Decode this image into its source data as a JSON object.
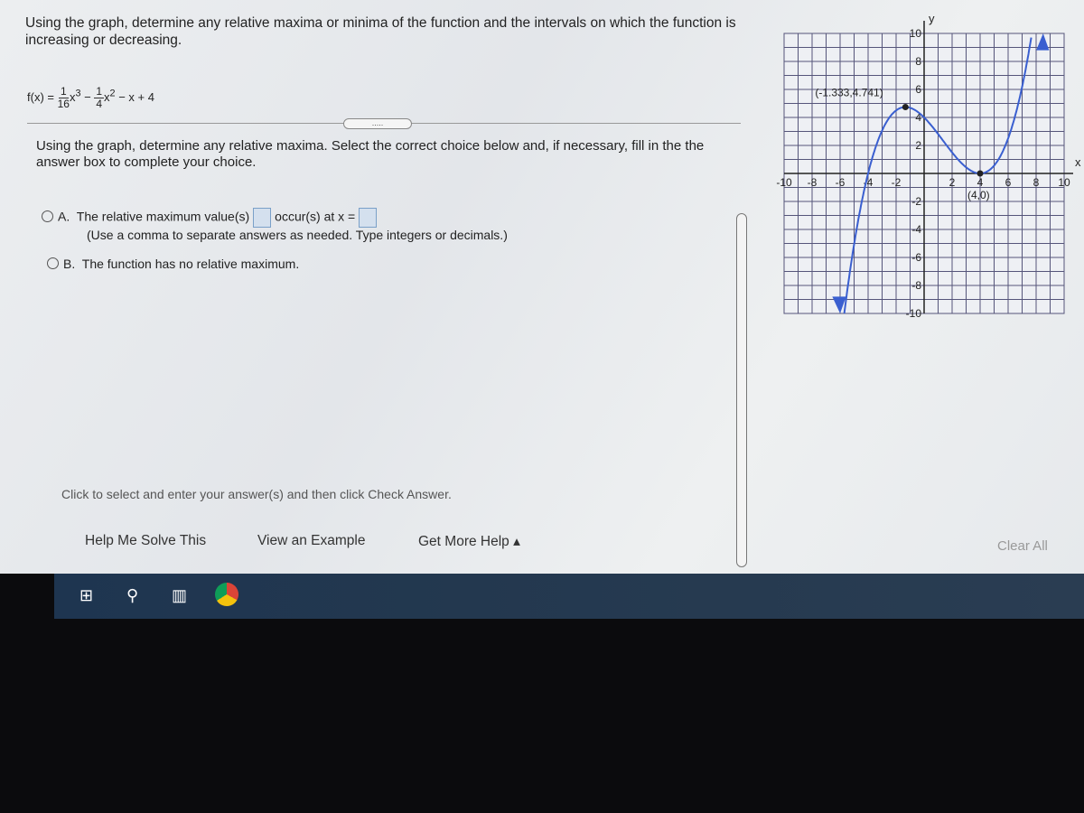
{
  "question": "Using the graph, determine any relative maxima or minima of the function and the intervals on which the function is increasing or decreasing.",
  "function": {
    "lhs": "f(x) =",
    "a_num": "1",
    "a_den": "16",
    "t1": "x",
    "e1": "3",
    "minus": "−",
    "b_num": "1",
    "b_den": "4",
    "t2": "x",
    "e2": "2",
    "rest": "− x + 4"
  },
  "more_button": ".....",
  "subquestion": "Using the graph, determine any relative maxima. Select the correct choice below and, if necessary, fill in the the answer box to complete your choice.",
  "option_a": {
    "letter": "A.",
    "text1": "The relative maximum value(s)",
    "text2": "occur(s) at x =",
    "hint": "(Use a comma to separate answers as needed. Type integers or decimals.)"
  },
  "option_b": {
    "letter": "B.",
    "text": "The function has no relative maximum."
  },
  "instruction": "Click to select and enter your answer(s) and then click Check Answer.",
  "footer": {
    "help": "Help Me Solve This",
    "example": "View an Example",
    "more_help": "Get More Help ▴",
    "clear": "Clear All"
  },
  "taskbar": {
    "icons": [
      "windows-icon",
      "search-icon",
      "task-view-icon",
      "chrome-icon"
    ]
  },
  "chart_data": {
    "type": "line",
    "function": "1/16 x^3 - 1/4 x^2 - x + 4",
    "xlabel": "x",
    "ylabel": "y",
    "xlim": [
      -10,
      10
    ],
    "ylim": [
      -10,
      10
    ],
    "xticks": [
      "-10",
      "-8",
      "-6",
      "-4",
      "-2",
      "2",
      "4",
      "6",
      "8",
      "10"
    ],
    "yticks": [
      "10",
      "8",
      "6",
      "4",
      "2",
      "-2",
      "-4",
      "-6",
      "-8",
      "-10"
    ],
    "grid": true,
    "line_color": "#3a5fd0",
    "points": [
      {
        "x": -1.333,
        "y": 4.741,
        "label": "(-1.333,4.741)"
      },
      {
        "x": 4,
        "y": 0,
        "label": "(4,0)"
      }
    ]
  }
}
